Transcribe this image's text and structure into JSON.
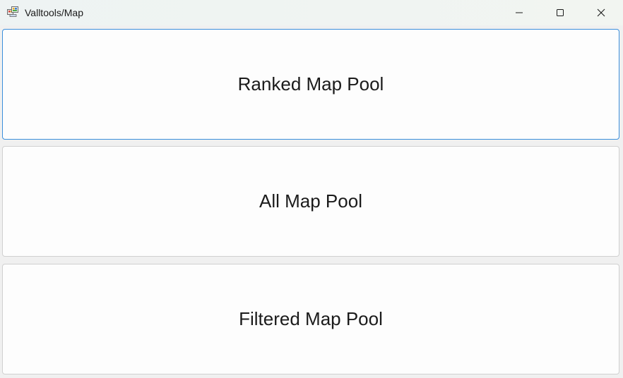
{
  "window": {
    "title": "Valltools/Map",
    "app_icon": "app-window-icon",
    "controls": {
      "minimize_icon": "minimize-icon",
      "maximize_icon": "maximize-icon",
      "close_icon": "close-icon"
    }
  },
  "buttons": [
    {
      "label": "Ranked Map Pool",
      "focused": true
    },
    {
      "label": "All Map Pool",
      "focused": false
    },
    {
      "label": "Filtered Map Pool",
      "focused": false
    }
  ],
  "colors": {
    "focus_border": "#3b8fdc",
    "button_background": "#fdfdfd",
    "window_background": "#f0f0f0"
  }
}
